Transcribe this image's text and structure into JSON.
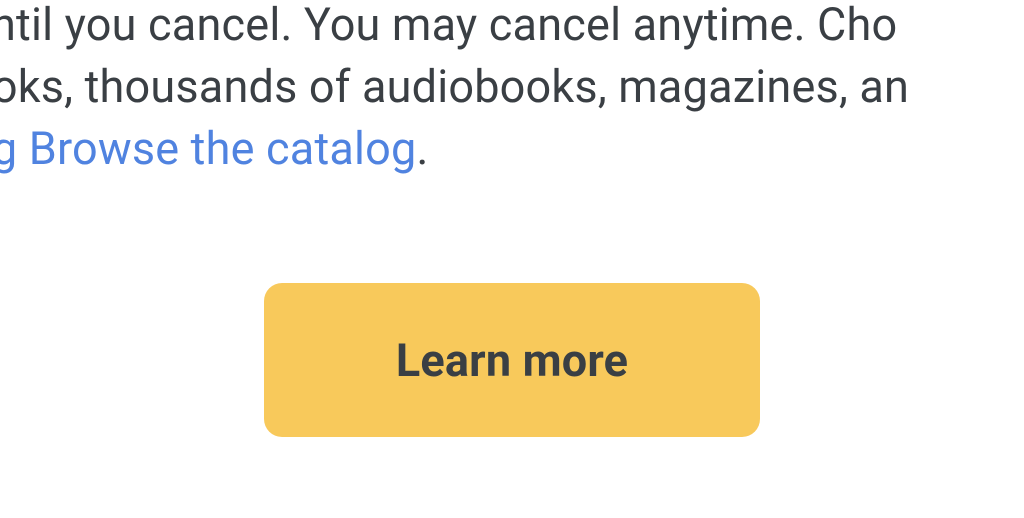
{
  "description": {
    "line1": "until you cancel. You may cancel anytime. Cho",
    "line2": "ooks, thousands of audiobooks, magazines, an",
    "link_prefix": "og ",
    "link_text": "Browse the catalog",
    "period": "."
  },
  "cta": {
    "learn_more_label": "Learn more"
  }
}
